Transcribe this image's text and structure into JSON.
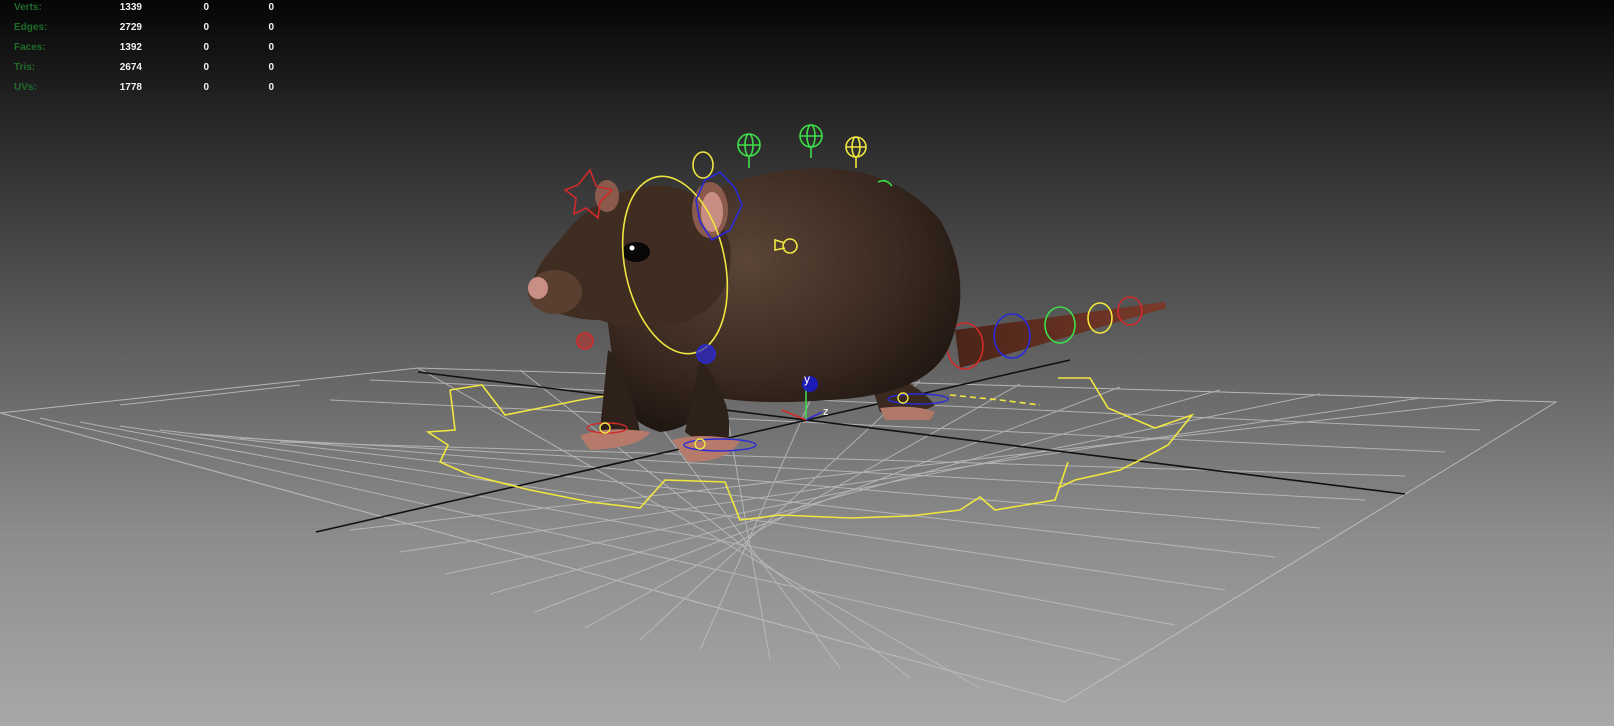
{
  "viewport": {
    "hud": [
      {
        "label": "Verts:",
        "v1": "1339",
        "v2": "0",
        "v3": "0"
      },
      {
        "label": "Edges:",
        "v1": "2729",
        "v2": "0",
        "v3": "0"
      },
      {
        "label": "Faces:",
        "v1": "1392",
        "v2": "0",
        "v3": "0"
      },
      {
        "label": "Tris:",
        "v1": "2674",
        "v2": "0",
        "v3": "0"
      },
      {
        "label": "UVs:",
        "v1": "1778",
        "v2": "0",
        "v3": "0"
      }
    ],
    "axis_label": "y",
    "axis_x_label": "z"
  },
  "colors": {
    "control_yellow": "#f0e640",
    "control_green": "#3ee04a",
    "control_blue": "#2a2ad8",
    "control_red": "#d02a2a",
    "grid": "#b9b9b9",
    "rat_fur": "#3b2a21"
  },
  "icons": [
    "rat-model",
    "grid-floor",
    "control-curves",
    "axis-gizmo"
  ]
}
